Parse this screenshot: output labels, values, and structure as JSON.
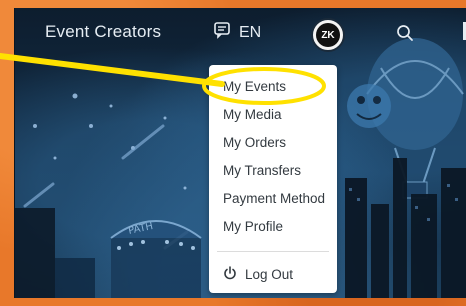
{
  "header": {
    "brand": "Event Creators",
    "language": "EN",
    "avatar_initials": "ZK",
    "icons": {
      "language": "chat-bubble-icon",
      "search": "search-icon",
      "more": "menu-icon"
    }
  },
  "account_menu": {
    "items": [
      {
        "label": "My Events",
        "highlighted": true
      },
      {
        "label": "My Media"
      },
      {
        "label": "My Orders"
      },
      {
        "label": "My Transfers"
      },
      {
        "label": "Payment Method"
      },
      {
        "label": "My Profile"
      }
    ],
    "logout": {
      "label": "Log Out",
      "icon": "power-icon"
    }
  },
  "annotation": {
    "color": "#ffe100",
    "target": "My Events"
  },
  "colors": {
    "frame": "#e8782a",
    "background": "#102236",
    "nav_text": "#e6edf3",
    "menu_bg": "#ffffff",
    "menu_text": "#333a40"
  }
}
